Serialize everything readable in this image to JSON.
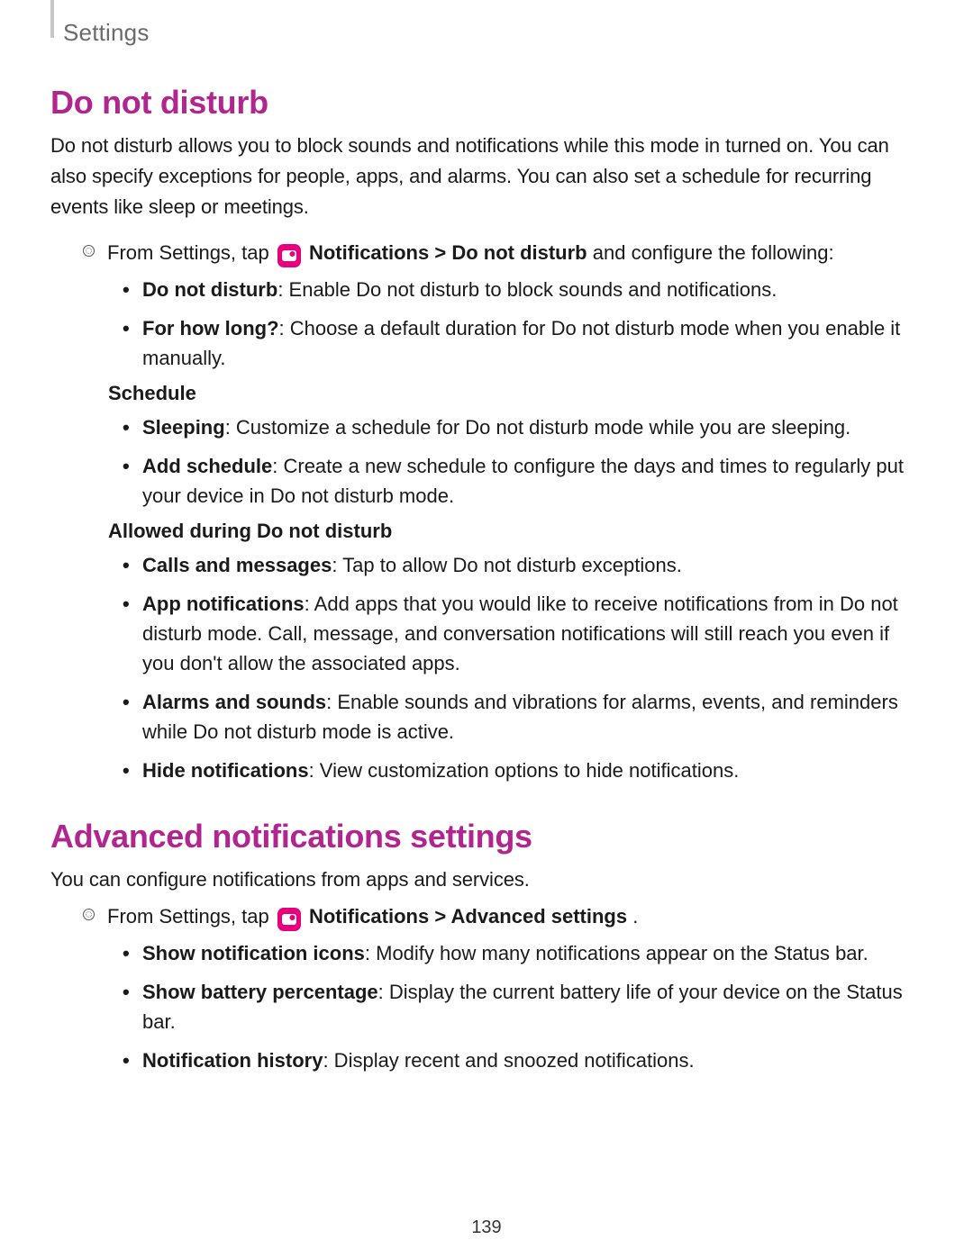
{
  "header": {
    "breadcrumb": "Settings"
  },
  "sections": {
    "dnd": {
      "title": "Do not disturb",
      "intro": "Do not disturb allows you to block sounds and notifications while this mode in turned on. You can also specify exceptions for people, apps, and alarms. You can also set a schedule for recurring events like sleep or meetings.",
      "lead_pre": "From Settings, tap ",
      "lead_bold1": "Notifications",
      "lead_sep": " > ",
      "lead_bold2": "Do not disturb",
      "lead_post": " and configure the following:",
      "items_top": [
        {
          "term": "Do not disturb",
          "desc": ": Enable Do not disturb to block sounds and notifications."
        },
        {
          "term": "For how long?",
          "desc": ": Choose a default duration for Do not disturb mode when you enable it manually."
        }
      ],
      "schedule_heading": "Schedule",
      "schedule_items": [
        {
          "term": "Sleeping",
          "desc": ": Customize a schedule for Do not disturb mode while you are sleeping."
        },
        {
          "term": "Add schedule",
          "desc": ": Create a new schedule to configure the days and times to regularly put your device in Do not disturb mode."
        }
      ],
      "allowed_heading": "Allowed during Do not disturb",
      "allowed_items": [
        {
          "term": "Calls and messages",
          "desc": ": Tap to allow Do not disturb exceptions."
        },
        {
          "term": "App notifications",
          "desc": ": Add apps that you would like to receive notifications from in Do not disturb mode. Call, message, and conversation notifications will still reach you even if you don't allow the associated apps."
        },
        {
          "term": "Alarms and sounds",
          "desc": ": Enable sounds and vibrations for alarms, events, and reminders while Do not disturb mode is active."
        },
        {
          "term": "Hide notifications",
          "desc": ": View customization options to hide notifications."
        }
      ]
    },
    "advanced": {
      "title": "Advanced notifications settings",
      "intro": "You can configure notifications from apps and services.",
      "lead_pre": "From Settings, tap ",
      "lead_bold1": "Notifications",
      "lead_sep": " > ",
      "lead_bold2": "Advanced settings",
      "lead_post": ".",
      "items": [
        {
          "term": "Show notification icons",
          "desc": ": Modify how many notifications appear on the Status bar."
        },
        {
          "term": "Show battery percentage",
          "desc": ": Display the current battery life of your device on the Status bar."
        },
        {
          "term": "Notification history",
          "desc": ": Display recent and snoozed notifications."
        }
      ]
    }
  },
  "page_number": "139"
}
